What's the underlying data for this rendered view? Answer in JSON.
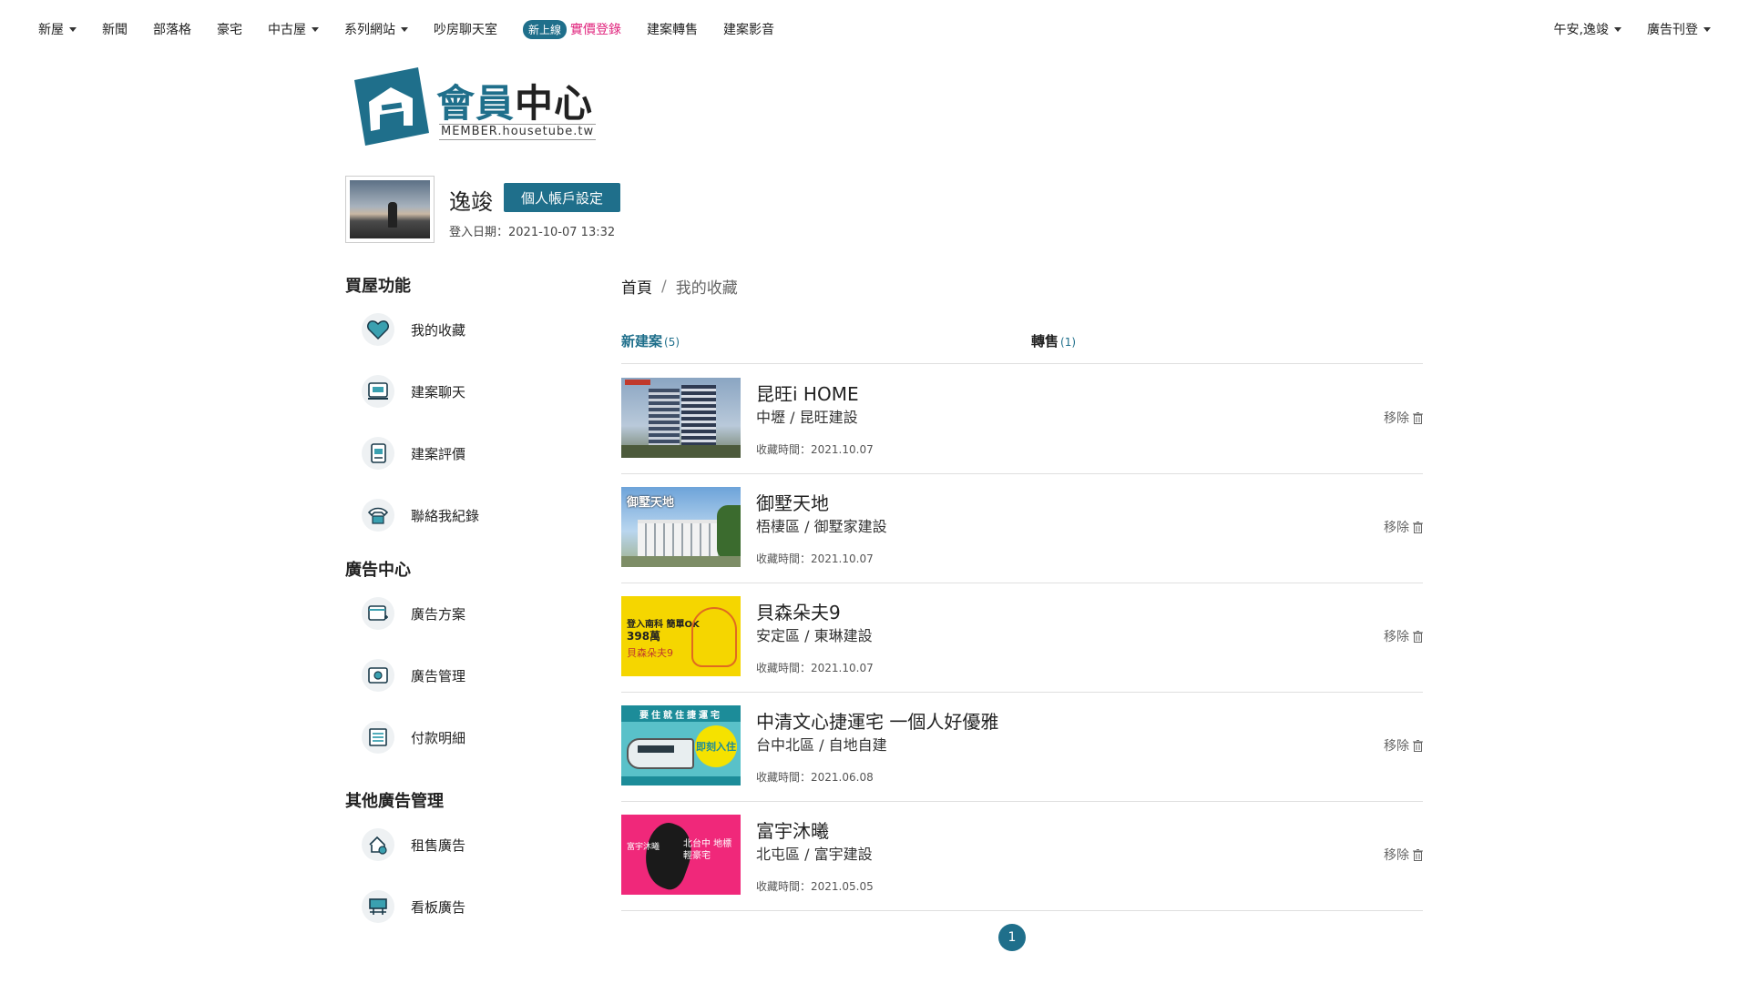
{
  "nav": {
    "left": [
      {
        "label": "新屋",
        "dropdown": true
      },
      {
        "label": "新聞",
        "dropdown": false
      },
      {
        "label": "部落格",
        "dropdown": false
      },
      {
        "label": "豪宅",
        "dropdown": false
      },
      {
        "label": "中古屋",
        "dropdown": true
      },
      {
        "label": "系列網站",
        "dropdown": true
      },
      {
        "label": "吵房聊天室",
        "dropdown": false
      }
    ],
    "badge": "新上線",
    "price_registry": "實價登錄",
    "after": [
      {
        "label": "建案轉售"
      },
      {
        "label": "建案影音"
      }
    ],
    "right": [
      {
        "label": "午安,逸竣"
      },
      {
        "label": "廣告刊登"
      }
    ]
  },
  "logo": {
    "title_part1": "會員",
    "title_part2": "中心",
    "subtitle": "MEMBER.housetube.tw"
  },
  "profile": {
    "username": "逸竣",
    "account_button": "個人帳戶設定",
    "login_date": "登入日期：2021-10-07 13:32"
  },
  "sidebar": {
    "sections": [
      {
        "title": "買屋功能",
        "items": [
          {
            "label": "我的收藏",
            "icon": "heart-icon"
          },
          {
            "label": "建案聊天",
            "icon": "chat-icon"
          },
          {
            "label": "建案評價",
            "icon": "review-icon"
          },
          {
            "label": "聯絡我紀錄",
            "icon": "phone-icon"
          }
        ]
      },
      {
        "title": "廣告中心",
        "items": [
          {
            "label": "廣告方案",
            "icon": "ad-plan-icon"
          },
          {
            "label": "廣告管理",
            "icon": "ad-manage-icon"
          },
          {
            "label": "付款明細",
            "icon": "payment-icon"
          }
        ]
      },
      {
        "title": "其他廣告管理",
        "items": [
          {
            "label": "租售廣告",
            "icon": "rent-icon"
          },
          {
            "label": "看板廣告",
            "icon": "billboard-icon"
          }
        ]
      }
    ]
  },
  "breadcrumb": {
    "home": "首頁",
    "separator": "/",
    "current": "我的收藏"
  },
  "tabs": [
    {
      "label": "新建案",
      "count": "(5)"
    },
    {
      "label": "轉售",
      "count": "(1)"
    }
  ],
  "favorites": [
    {
      "title": "昆旺i HOME",
      "location": "中壢 / 昆旺建設",
      "time": "收藏時間：2021.10.07",
      "remove": "移除"
    },
    {
      "title": "御墅天地",
      "location": "梧棲區 / 御墅家建設",
      "time": "收藏時間：2021.10.07",
      "remove": "移除"
    },
    {
      "title": "貝森朵夫9",
      "location": "安定區 / 東琳建設",
      "time": "收藏時間：2021.10.07",
      "remove": "移除"
    },
    {
      "title": "中清文心捷運宅 一個人好優雅",
      "location": "台中北區 / 自地自建",
      "time": "收藏時間：2021.06.08",
      "remove": "移除"
    },
    {
      "title": "富宇沐曦",
      "location": "北屯區 / 富宇建設",
      "time": "收藏時間：2021.05.05",
      "remove": "移除"
    }
  ],
  "thumbs": {
    "t2_label": "御墅天地",
    "t3_l1": "登入南科 簡單OK",
    "t3_l2": "398萬",
    "t3_l3": "貝森朵夫9",
    "t4_top": "要住就住捷運宅",
    "t4_circle": "即刻入住",
    "t5_txt1": "富宇沐曦",
    "t5_txt2": "北台中 地標輕豪宅"
  },
  "pagination": {
    "current": "1"
  },
  "colors": {
    "accent": "#1f6f8b",
    "pink": "#e0247d"
  }
}
